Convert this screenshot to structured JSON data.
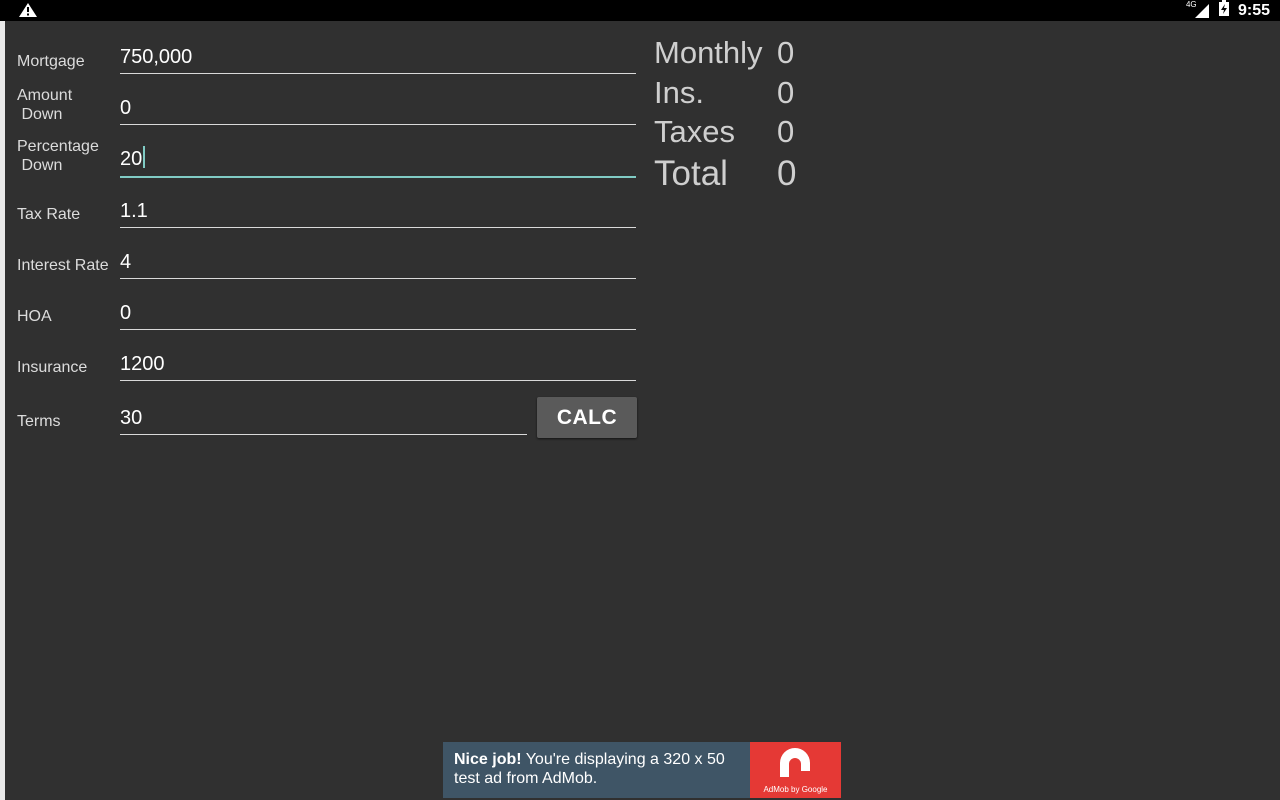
{
  "status_bar": {
    "network": "4G",
    "time": "9:55"
  },
  "form": {
    "mortgage": {
      "label": "Mortgage",
      "value": "750,000"
    },
    "amount_down": {
      "label": "Amount\n Down",
      "value": "0"
    },
    "percentage_down": {
      "label": "Percentage\n Down",
      "value": "20"
    },
    "tax_rate": {
      "label": "Tax Rate",
      "value": "1.1"
    },
    "interest_rate": {
      "label": "Interest Rate",
      "value": "4"
    },
    "hoa": {
      "label": "HOA",
      "value": "0"
    },
    "insurance": {
      "label": "Insurance",
      "value": "1200"
    },
    "terms": {
      "label": "Terms",
      "value": "30"
    },
    "calc_label": "CALC"
  },
  "results": {
    "monthly": {
      "label": "Monthly",
      "value": "0"
    },
    "ins": {
      "label": "Ins.",
      "value": "0"
    },
    "taxes": {
      "label": "Taxes",
      "value": "0"
    },
    "total": {
      "label": "Total",
      "value": "0"
    }
  },
  "ad": {
    "headline": "Nice job!",
    "body": " You're displaying a 320 x 50 test ad from AdMob.",
    "logo_caption": "AdMob by Google"
  },
  "colors": {
    "background": "#303030",
    "accent": "#80cbc4",
    "ad_background": "#3f5566",
    "ad_logo": "#e53935"
  },
  "icons": [
    "warning-icon",
    "signal-icon",
    "battery-icon",
    "admob-logo-icon"
  ]
}
